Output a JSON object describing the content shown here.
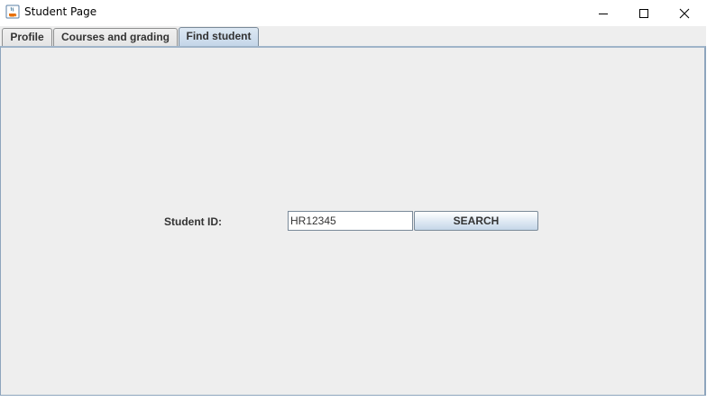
{
  "window": {
    "title": "Student Page",
    "icon": "java-coffee-cup-icon"
  },
  "window_controls": {
    "minimize_icon": "minimize-icon",
    "maximize_icon": "maximize-icon",
    "close_icon": "close-icon"
  },
  "tabs": [
    {
      "label": "Profile",
      "selected": false
    },
    {
      "label": "Courses and grading",
      "selected": false
    },
    {
      "label": "Find student",
      "selected": true
    }
  ],
  "find_student": {
    "id_label": "Student ID:",
    "id_value": "HR12345",
    "search_label": "SEARCH"
  },
  "colors": {
    "panel_background": "#eeeeee",
    "selected_tab": "#c3d5e8",
    "border": "#8ea5bd"
  }
}
